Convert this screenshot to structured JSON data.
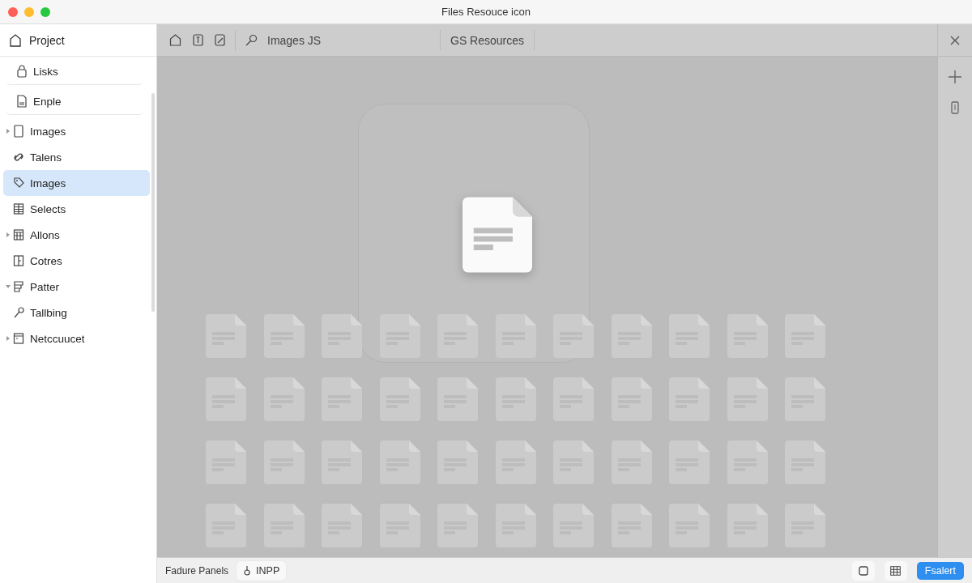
{
  "window": {
    "title": "Files Resouce icon"
  },
  "sidebar": {
    "header": "Project",
    "items": [
      {
        "label": "Lisks",
        "selected": false
      },
      {
        "label": "Enple",
        "selected": false
      },
      {
        "label": "Images",
        "selected": false,
        "expanded": false
      },
      {
        "label": "Talens",
        "selected": false
      },
      {
        "label": "Images",
        "selected": true
      },
      {
        "label": "Selects",
        "selected": false
      },
      {
        "label": "Allons",
        "selected": false,
        "expanded": false
      },
      {
        "label": "Cotres",
        "selected": false
      },
      {
        "label": "Patter",
        "selected": false,
        "expanded": true
      },
      {
        "label": "Tallbing",
        "selected": false
      },
      {
        "label": "Netccuucet",
        "selected": false,
        "expanded": false
      }
    ]
  },
  "toolbar": {
    "search": "Images JS",
    "tab": "GS Resources"
  },
  "bottom_bar": {
    "label": "Fadure Panels",
    "chip": "INPP",
    "primary_button": "Fsalert"
  }
}
